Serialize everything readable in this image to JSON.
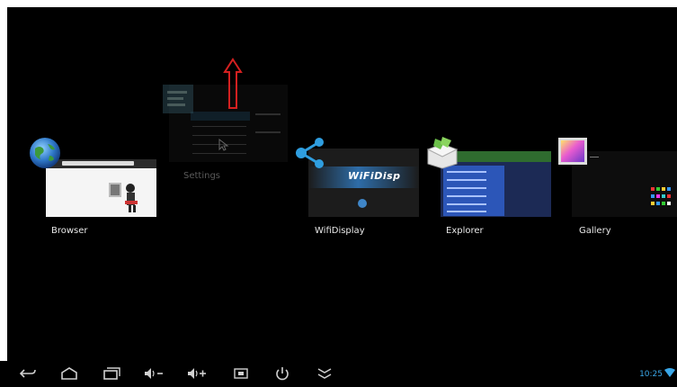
{
  "recents": {
    "browser": {
      "label": "Browser",
      "icon": "globe-icon"
    },
    "settings": {
      "label": "Settings",
      "icon": "settings-icon"
    },
    "wifidisplay": {
      "label": "WifiDisplay",
      "icon": "share-icon",
      "banner": "WiFiDisp"
    },
    "explorer": {
      "label": "Explorer",
      "icon": "folder-icon"
    },
    "gallery": {
      "label": "Gallery",
      "icon": "gallery-icon"
    }
  },
  "annotation": {
    "icon": "red-up-arrow"
  },
  "navbar": {
    "icons": [
      "back-icon",
      "home-icon",
      "recent-apps-icon",
      "volume-down-icon",
      "volume-up-icon",
      "screenshot-icon",
      "power-icon",
      "hide-bar-icon"
    ],
    "time": "10:25",
    "accent": "#3aa7e8"
  }
}
